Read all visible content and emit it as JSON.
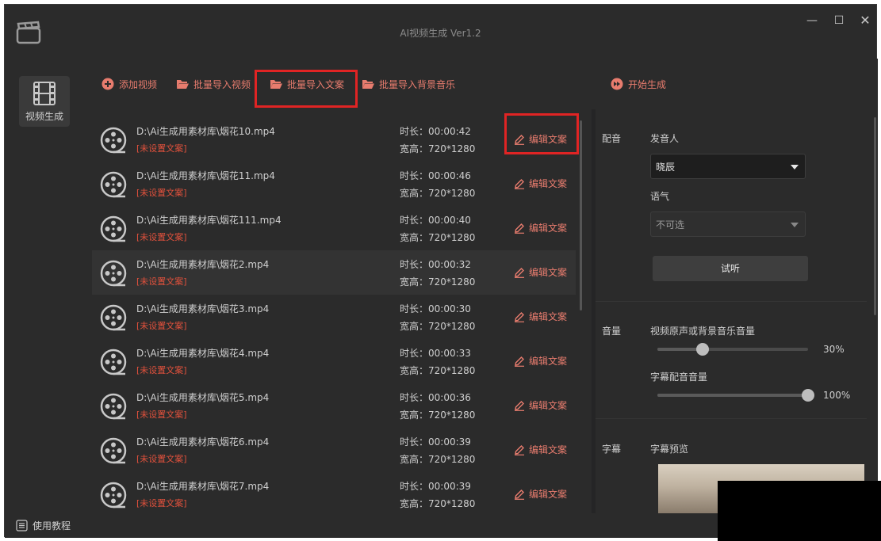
{
  "window": {
    "title": "AI视频生成 Ver1.2"
  },
  "sidebar": {
    "items": [
      {
        "label": "视频生成"
      }
    ]
  },
  "toolbar": {
    "add_video": "添加视频",
    "batch_import_video": "批量导入视频",
    "batch_import_text": "批量导入文案",
    "batch_import_bgm": "批量导入背景音乐",
    "start": "开始生成"
  },
  "videos": [
    {
      "path": "D:\\Ai生成用素材库\\烟花10.mp4",
      "status": "[未设置文案]",
      "duration": "时长：00:00:42",
      "size": "宽高：720*1280",
      "edit": "编辑文案"
    },
    {
      "path": "D:\\Ai生成用素材库\\烟花11.mp4",
      "status": "[未设置文案]",
      "duration": "时长：00:00:46",
      "size": "宽高：720*1280",
      "edit": "编辑文案"
    },
    {
      "path": "D:\\Ai生成用素材库\\烟花111.mp4",
      "status": "[未设置文案]",
      "duration": "时长：00:00:40",
      "size": "宽高：720*1280",
      "edit": "编辑文案"
    },
    {
      "path": "D:\\Ai生成用素材库\\烟花2.mp4",
      "status": "[未设置文案]",
      "duration": "时长：00:00:32",
      "size": "宽高：720*1280",
      "edit": "编辑文案"
    },
    {
      "path": "D:\\Ai生成用素材库\\烟花3.mp4",
      "status": "[未设置文案]",
      "duration": "时长：00:00:30",
      "size": "宽高：720*1280",
      "edit": "编辑文案"
    },
    {
      "path": "D:\\Ai生成用素材库\\烟花4.mp4",
      "status": "[未设置文案]",
      "duration": "时长：00:00:33",
      "size": "宽高：720*1280",
      "edit": "编辑文案"
    },
    {
      "path": "D:\\Ai生成用素材库\\烟花5.mp4",
      "status": "[未设置文案]",
      "duration": "时长：00:00:36",
      "size": "宽高：720*1280",
      "edit": "编辑文案"
    },
    {
      "path": "D:\\Ai生成用素材库\\烟花6.mp4",
      "status": "[未设置文案]",
      "duration": "时长：00:00:39",
      "size": "宽高：720*1280",
      "edit": "编辑文案"
    },
    {
      "path": "D:\\Ai生成用素材库\\烟花7.mp4",
      "status": "[未设置文案]",
      "duration": "时长：00:00:39",
      "size": "宽高：720*1280",
      "edit": "编辑文案"
    }
  ],
  "voice": {
    "section": "配音",
    "speaker_label": "发音人",
    "speaker_value": "晓辰",
    "tone_label": "语气",
    "tone_value": "不可选",
    "listen": "试听"
  },
  "volume": {
    "section": "音量",
    "original_label": "视频原声或背景音乐音量",
    "original_value": "30%",
    "original_level": 0.3,
    "subtitle_label": "字幕配音音量",
    "subtitle_value": "100%",
    "subtitle_level": 1.0
  },
  "subtitle": {
    "section": "字幕",
    "preview_label": "字幕预览"
  },
  "statusbar": {
    "tutorial": "使用教程"
  },
  "colors": {
    "accent": "#e87c6e",
    "warning": "#e0513c",
    "highlight": "#e02424",
    "background": "#252526"
  }
}
